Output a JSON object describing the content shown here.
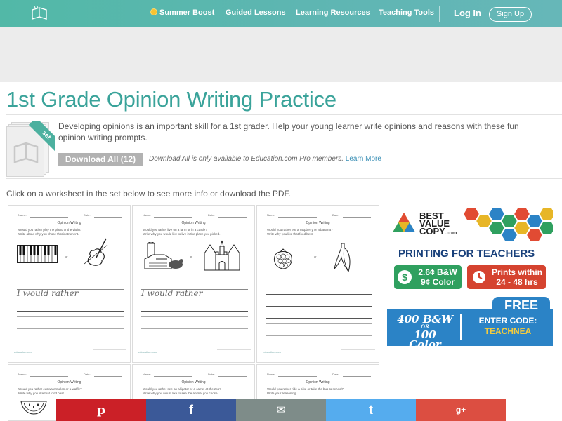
{
  "nav": {
    "summer": "Summer Boost",
    "guided": "Guided Lessons",
    "resources": "Learning Resources",
    "tools": "Teaching Tools",
    "login": "Log In",
    "signup": "Sign Up"
  },
  "page": {
    "title": "1st Grade Opinion Writing Practice",
    "set_badge": "set",
    "description": "Developing opinions is an important skill for a 1st grader. Help your young learner write opinions and reasons with these fun opinion writing prompts.",
    "download_button": "Download All (12)",
    "download_note": "Download All is only available to Education.com Pro members.",
    "learn_more": "Learn More",
    "instructions": "Click on a worksheet in the set below to see more info or download the PDF."
  },
  "worksheet_labels": {
    "name": "Name:",
    "date": "Date:",
    "heading": "Opinion Writing",
    "or": "or",
    "rather": "I would rather",
    "brand": "education.com"
  },
  "worksheets": [
    {
      "q1": "Would you rather play the piano or the violin?",
      "q2": "Write about why you chose that instrument."
    },
    {
      "q1": "Would you rather live on a farm or in a castle?",
      "q2": "Write why you would like to live in the place you picked."
    },
    {
      "q1": "Would you rather eat a raspberry or a banana?",
      "q2": "Write why you like that food best."
    },
    {
      "q1": "Would you rather eat watermelon or a waffle?",
      "q2": "Write why you like that food best."
    },
    {
      "q1": "Would you rather see an alligator or a camel at the zoo?",
      "q2": "Write why you would like to see the animal you chose."
    },
    {
      "q1": "Would you rather ride a bike or take the bus to school?",
      "q2": "Write your reasoning."
    }
  ],
  "ad": {
    "brand_line1": "BEST",
    "brand_line2": "VALUE",
    "brand_line3": "COPY",
    "brand_suffix": ".com",
    "headline": "PRINTING FOR TEACHERS",
    "price1": "2.6¢ B&W",
    "price2": "9¢ Color",
    "print1": "Prints within",
    "print2": "24 - 48 hrs",
    "free": "FREE",
    "offer1": "400 B&W",
    "offer_or": "OR",
    "offer2": "100 Color",
    "code_label": "ENTER CODE:",
    "code": "TEACHNEA"
  },
  "share": {
    "pinterest": "p",
    "facebook": "f",
    "email": "✉",
    "twitter": "t",
    "google": "g+"
  },
  "colors": {
    "nav": "#5fb6b3",
    "title": "#3aa39a",
    "pinterest": "#cb2027",
    "facebook": "#3b5998",
    "email": "#7e8c89",
    "twitter": "#55acee",
    "google": "#dc4e41"
  }
}
